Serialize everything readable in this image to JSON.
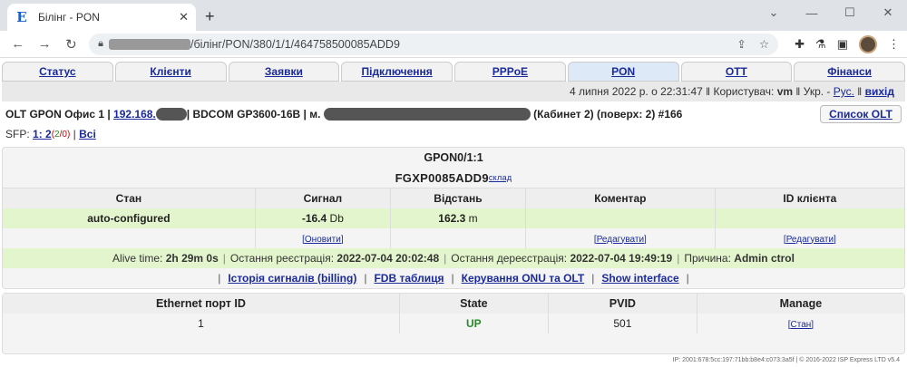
{
  "browser": {
    "tab_title": "Білінг - PON",
    "favicon_letter": "E",
    "url_path": "/білінг/PON/380/1/1/464758500085ADD9"
  },
  "nav": [
    {
      "label": "Статус",
      "active": false
    },
    {
      "label": "Клієнти",
      "active": false
    },
    {
      "label": "Заявки",
      "active": false
    },
    {
      "label": "Підключення",
      "active": false
    },
    {
      "label": "PPPoE",
      "active": false
    },
    {
      "label": "PON",
      "active": true
    },
    {
      "label": "OTT",
      "active": false
    },
    {
      "label": "Фінанси",
      "active": false
    }
  ],
  "infobar": {
    "datetime": "4 липня 2022 р. о 22:31:47",
    "sep": "‖",
    "user_label": "Користувач:",
    "user": "vm",
    "lang_prefix": "Укр. -",
    "lang_link": "Рус.",
    "logout": "вихід"
  },
  "olt": {
    "name_prefix": "OLT GPON Офис 1 |",
    "ip": "192.168.",
    "model": "| BDCOM GP3600-16B | м.",
    "location_suffix": "(Кабинет 2) (поверх: 2) #166",
    "list_link": "Список OLT"
  },
  "sfp": {
    "label": "SFP:",
    "link": "1: 2",
    "paren_open": "(",
    "n1": "2",
    "slash": "/",
    "n2": "0",
    "paren_close": ")",
    "sep": "|",
    "all": "Всі"
  },
  "onu": {
    "port": "GPON0/1:1",
    "serial": "FGXP0085ADD9",
    "warehouse_link": "склад",
    "headers": [
      "Стан",
      "Сигнал",
      "Відстань",
      "Коментар",
      "ID клієнта"
    ],
    "state": "auto-configured",
    "signal": "-16.4",
    "signal_unit": "Db",
    "distance": "162.3",
    "distance_unit": "m",
    "comment": "",
    "client_id": "",
    "refresh_link": "[Оновити]",
    "edit_comment_link": "[Редагувати]",
    "edit_client_link": "[Редагувати]"
  },
  "alive": {
    "alive_label": "Alive time:",
    "alive_value": "2h 29m 0s",
    "reg_label": "Остання реєстрація:",
    "reg_value": "2022-07-04 20:02:48",
    "dereg_label": "Остання дереєстрація:",
    "dereg_value": "2022-07-04 19:49:19",
    "reason_label": "Причина:",
    "reason_value": "Admin ctrol",
    "sep": "|"
  },
  "actions": {
    "sep": "|",
    "history": "Історія сигналів (billing)",
    "fdb": "FDB таблиця",
    "manage": "Керування ONU та OLT",
    "show": "Show interface"
  },
  "ethernet": {
    "headers": [
      "Ethernet порт ID",
      "State",
      "PVID",
      "Manage"
    ],
    "rows": [
      {
        "port": "1",
        "state": "UP",
        "pvid": "501",
        "manage": "[Стан]"
      }
    ]
  },
  "footer": "IP: 2001:678:5cc:197:71bb:b8e4:c073:3a5f | © 2016-2022 ISP Express LTD v5.4"
}
